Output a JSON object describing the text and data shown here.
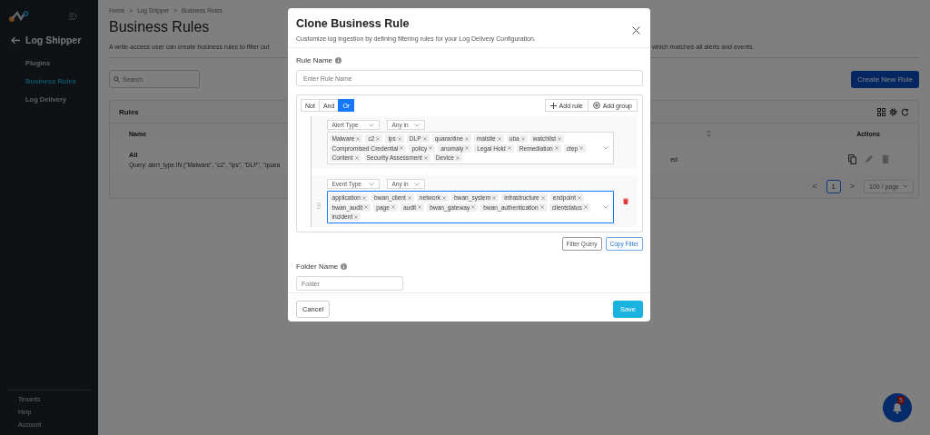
{
  "sidebar": {
    "section": "Log Shipper",
    "items": [
      {
        "label": "Plugins",
        "selected": false
      },
      {
        "label": "Business Rules",
        "selected": true
      },
      {
        "label": "Log Delivery",
        "selected": false
      }
    ],
    "footer_items": [
      "Tenants",
      "Help",
      "Account"
    ]
  },
  "breadcrumb": {
    "items": [
      "Home",
      "Log Shipper",
      "Business Rules"
    ],
    "separator": ">"
  },
  "page": {
    "title": "Business Rules",
    "description_start": "A write-access user can create business rules to filter out",
    "description_end": "which matches all alerts and events.",
    "search_placeholder": "Search",
    "create_button": "Create New Rule"
  },
  "table": {
    "title": "Rules",
    "columns": [
      "Name",
      "Actions"
    ],
    "rows": [
      {
        "name": "All",
        "query": "Query: alert_type IN (\"Malware\", \"c2\", \"ips\", \"DLP\", \"quara",
        "column_2": "ed"
      }
    ],
    "pagination": {
      "prev": "<",
      "next": ">",
      "pages": [
        {
          "label": "1",
          "selected": true
        }
      ],
      "page_size": "100 / page"
    }
  },
  "modal": {
    "title": "Clone Business Rule",
    "subtitle": "Customize log ingestion by defining filtering rules for your Log Delivery Configuration.",
    "rule_name": {
      "label": "Rule Name",
      "placeholder": "Enter Rule Name"
    },
    "combinators": [
      {
        "label": "Not",
        "selected": false
      },
      {
        "label": "And",
        "selected": false
      },
      {
        "label": "Or",
        "selected": true
      }
    ],
    "builder_actions": [
      {
        "kind": "rule",
        "label": "Add rule"
      },
      {
        "kind": "group",
        "label": "Add group"
      }
    ],
    "rules": [
      {
        "field": "Alert Type",
        "operator": "Any in",
        "hovered": false,
        "values": [
          "Malware",
          "c2",
          "ips",
          "DLP",
          "quarantine",
          "malsite",
          "uba",
          "watchlist",
          "Compromised Credential",
          "policy",
          "anomaly",
          "Legal Hold",
          "Remediation",
          "ctep",
          "Content",
          "Security Assessment",
          "Device"
        ]
      },
      {
        "field": "Event Type",
        "operator": "Any in",
        "hovered": true,
        "values": [
          "application",
          "bwan_client",
          "network",
          "bwan_system",
          "infrastructure",
          "endpoint",
          "bwan_audit",
          "page",
          "audit",
          "bwan_gateway",
          "bwan_authentication",
          "clientstatus",
          "incident"
        ]
      }
    ],
    "query_buttons": [
      {
        "label": "Filter Query",
        "selected": false
      },
      {
        "label": "Copy Filter",
        "selected": true
      }
    ],
    "folder": {
      "label": "Folder Name",
      "placeholder": "Folder"
    },
    "cancel": "Cancel",
    "save": "Save"
  },
  "notifications": {
    "count": "5"
  }
}
